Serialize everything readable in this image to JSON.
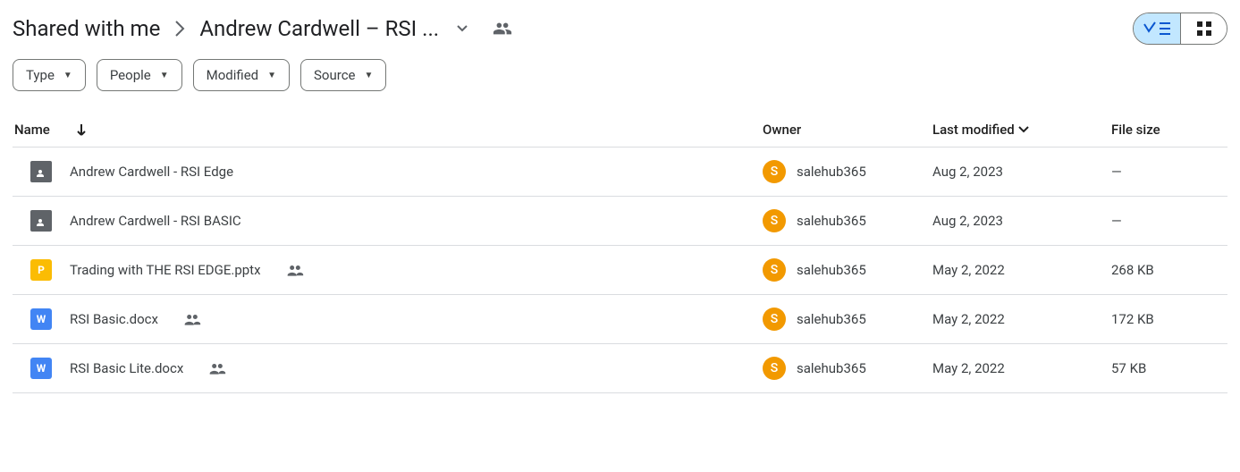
{
  "breadcrumb": {
    "root": "Shared with me",
    "current": "Andrew Cardwell – RSI ..."
  },
  "filters": {
    "type": "Type",
    "people": "People",
    "modified": "Modified",
    "source": "Source"
  },
  "columns": {
    "name": "Name",
    "owner": "Owner",
    "modified": "Last modified",
    "size": "File size"
  },
  "owner_initial": "S",
  "rows": [
    {
      "kind": "folder",
      "name": "Andrew Cardwell - RSI Edge",
      "shared": false,
      "owner": "salehub365",
      "modified": "Aug 2, 2023",
      "size": "—"
    },
    {
      "kind": "folder",
      "name": "Andrew Cardwell - RSI BASIC",
      "shared": false,
      "owner": "salehub365",
      "modified": "Aug 2, 2023",
      "size": "—"
    },
    {
      "kind": "ppt",
      "name": "Trading with THE RSI EDGE.pptx",
      "shared": true,
      "owner": "salehub365",
      "modified": "May 2, 2022",
      "size": "268 KB"
    },
    {
      "kind": "doc",
      "name": "RSI Basic.docx",
      "shared": true,
      "owner": "salehub365",
      "modified": "May 2, 2022",
      "size": "172 KB"
    },
    {
      "kind": "doc",
      "name": "RSI Basic Lite.docx",
      "shared": true,
      "owner": "salehub365",
      "modified": "May 2, 2022",
      "size": "57 KB"
    }
  ]
}
